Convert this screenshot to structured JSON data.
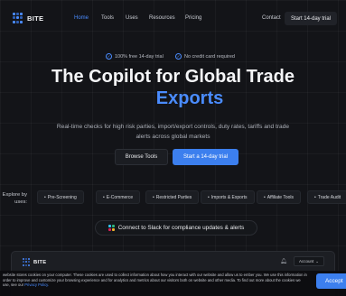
{
  "header": {
    "logo_text": "BITE",
    "nav": [
      "Home",
      "Tools",
      "Uses",
      "Resources",
      "Pricing"
    ],
    "contact": "Contact",
    "trial_button": "Start 14-day trial"
  },
  "hero": {
    "badges": [
      "100% free 14-day trial",
      "No credit card required"
    ],
    "title_line1": "The Copilot for Global Trade",
    "title_line2": "Exports",
    "subtitle": "Real-time checks for high risk parties, import/export controls, duty rates, tariffs and trade alerts across global markets",
    "browse_button": "Browse Tools",
    "trial_button": "Start a 14-day trial"
  },
  "explore": {
    "label": "Explore by uses:",
    "chips": [
      "Pre-Screening",
      "E-Commerce",
      "Restricted Parties",
      "Imports & Exports",
      "Affiliate Tools",
      "Trade Audit"
    ]
  },
  "slack": {
    "text": "Connect to Slack for compliance updates & alerts"
  },
  "preview": {
    "logo_text": "BITE",
    "account_label": "Account"
  },
  "cookie": {
    "text": "website stores cookies on your computer. These cookies are used to collect information about how you interact with our website and allow us to ember you. We use this information in order to improve and customize your browsing experience and for analytics and metrics about our visitors both on website and other media. To find out more about the cookies we use, see our",
    "link": "Privacy Policy.",
    "accept": "Accept"
  },
  "colors": {
    "accent": "#4a8cff",
    "background": "#131418",
    "slack_green": "#2eb67d",
    "slack_blue": "#36c5f0",
    "slack_yellow": "#ecb22e",
    "slack_red": "#e01e5a"
  }
}
